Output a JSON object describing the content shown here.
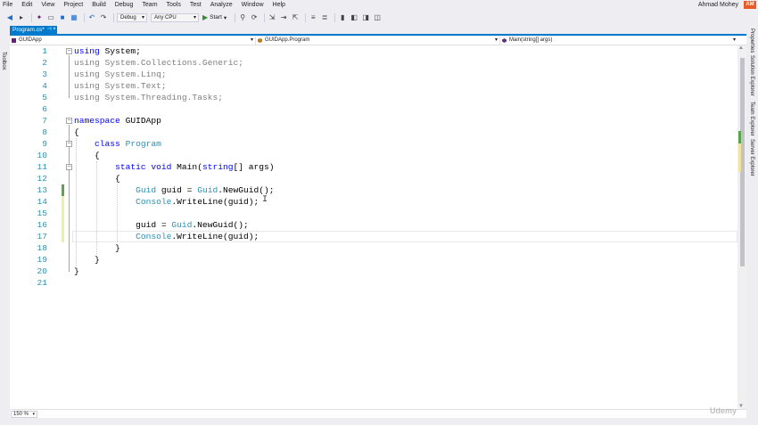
{
  "menubar": {
    "items": [
      "File",
      "Edit",
      "View",
      "Project",
      "Build",
      "Debug",
      "Team",
      "Tools",
      "Test",
      "Analyze",
      "Window",
      "Help"
    ],
    "user_name": "Ahmad Mohey",
    "user_initials": "AM"
  },
  "toolbar": {
    "config": "Debug",
    "platform": "Any CPU",
    "start_label": "Start"
  },
  "left_strip": {
    "toolbox_label": "Toolbox"
  },
  "right_strip": {
    "tabs": [
      "Properties",
      "Solution Explorer",
      "Team Explorer",
      "Server Explorer"
    ]
  },
  "doc_tab": {
    "label": "Program.cs*"
  },
  "navbar": {
    "project": "GUIDApp",
    "class": "GUIDApp.Program",
    "member": "Main(string[] args)"
  },
  "editor": {
    "lines": [
      {
        "n": "1",
        "segs": [
          {
            "t": "using",
            "c": "kw"
          },
          {
            "t": " System;",
            "c": ""
          }
        ]
      },
      {
        "n": "2",
        "segs": [
          {
            "t": "using System.Collections.Generic;",
            "c": "dim"
          }
        ]
      },
      {
        "n": "3",
        "segs": [
          {
            "t": "using System.Linq;",
            "c": "dim"
          }
        ]
      },
      {
        "n": "4",
        "segs": [
          {
            "t": "using System.Text;",
            "c": "dim"
          }
        ]
      },
      {
        "n": "5",
        "segs": [
          {
            "t": "using System.Threading.Tasks;",
            "c": "dim"
          }
        ]
      },
      {
        "n": "6",
        "segs": []
      },
      {
        "n": "7",
        "segs": [
          {
            "t": "namespace",
            "c": "kw"
          },
          {
            "t": " GUIDApp",
            "c": ""
          }
        ]
      },
      {
        "n": "8",
        "segs": [
          {
            "t": "{",
            "c": ""
          }
        ]
      },
      {
        "n": "9",
        "segs": [
          {
            "t": "    ",
            "c": ""
          },
          {
            "t": "class",
            "c": "kw"
          },
          {
            "t": " ",
            "c": ""
          },
          {
            "t": "Program",
            "c": "ty"
          }
        ]
      },
      {
        "n": "10",
        "segs": [
          {
            "t": "    {",
            "c": ""
          }
        ]
      },
      {
        "n": "11",
        "segs": [
          {
            "t": "        ",
            "c": ""
          },
          {
            "t": "static",
            "c": "kw"
          },
          {
            "t": " ",
            "c": ""
          },
          {
            "t": "void",
            "c": "kw"
          },
          {
            "t": " Main(",
            "c": ""
          },
          {
            "t": "string",
            "c": "kw"
          },
          {
            "t": "[] args)",
            "c": ""
          }
        ]
      },
      {
        "n": "12",
        "segs": [
          {
            "t": "        {",
            "c": ""
          }
        ]
      },
      {
        "n": "13",
        "segs": [
          {
            "t": "            ",
            "c": ""
          },
          {
            "t": "Guid",
            "c": "ty"
          },
          {
            "t": " guid = ",
            "c": ""
          },
          {
            "t": "Guid",
            "c": "ty"
          },
          {
            "t": ".NewGuid();",
            "c": ""
          }
        ]
      },
      {
        "n": "14",
        "segs": [
          {
            "t": "            ",
            "c": ""
          },
          {
            "t": "Console",
            "c": "ty"
          },
          {
            "t": ".WriteLine(guid);",
            "c": ""
          }
        ]
      },
      {
        "n": "15",
        "segs": []
      },
      {
        "n": "16",
        "segs": [
          {
            "t": "            guid = ",
            "c": ""
          },
          {
            "t": "Guid",
            "c": "ty"
          },
          {
            "t": ".NewGuid();",
            "c": ""
          }
        ]
      },
      {
        "n": "17",
        "segs": [
          {
            "t": "            ",
            "c": ""
          },
          {
            "t": "Console",
            "c": "ty"
          },
          {
            "t": ".WriteLine(guid);",
            "c": ""
          }
        ]
      },
      {
        "n": "18",
        "segs": [
          {
            "t": "        }",
            "c": ""
          }
        ]
      },
      {
        "n": "19",
        "segs": [
          {
            "t": "    }",
            "c": ""
          }
        ]
      },
      {
        "n": "20",
        "segs": [
          {
            "t": "}",
            "c": ""
          }
        ]
      },
      {
        "n": "21",
        "segs": []
      }
    ],
    "change_marks": {
      "13": "saved",
      "14": "unsaved",
      "15": "unsaved",
      "16": "unsaved",
      "17": "unsaved"
    },
    "current_line": "17"
  },
  "zoom": {
    "value": "150 %"
  },
  "colors": {
    "accent": "#007ACC",
    "keyword": "#0000FF",
    "type": "#2B91AF",
    "saved_change": "#57A64A",
    "unsaved_change": "#EFEF9E"
  },
  "watermark": "Udemy"
}
